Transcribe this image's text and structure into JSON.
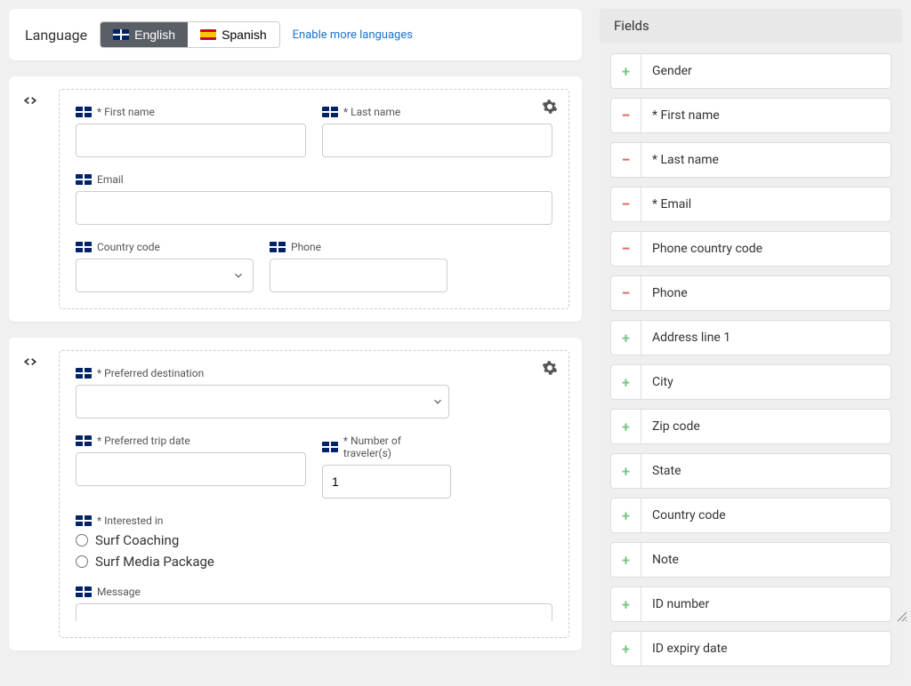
{
  "lang": {
    "label": "Language",
    "english": "English",
    "spanish": "Spanish",
    "more": "Enable more languages"
  },
  "section1": {
    "first_name": "* First name",
    "last_name": "* Last name",
    "email": "Email",
    "country_code": "Country code",
    "phone": "Phone"
  },
  "section2": {
    "destination": "* Preferred destination",
    "trip_date": "* Preferred trip date",
    "travelers": "* Number of traveler(s)",
    "travelers_value": "1",
    "interested": "* Interested in",
    "opt1": "Surf Coaching",
    "opt2": "Surf Media Package",
    "message": "Message"
  },
  "fields": {
    "title": "Fields",
    "items": [
      {
        "action": "add",
        "label": "Gender"
      },
      {
        "action": "remove",
        "label": "* First name"
      },
      {
        "action": "remove",
        "label": "* Last name"
      },
      {
        "action": "remove",
        "label": "* Email"
      },
      {
        "action": "remove",
        "label": "Phone country code"
      },
      {
        "action": "remove",
        "label": "Phone"
      },
      {
        "action": "add",
        "label": "Address line 1"
      },
      {
        "action": "add",
        "label": "City"
      },
      {
        "action": "add",
        "label": "Zip code"
      },
      {
        "action": "add",
        "label": "State"
      },
      {
        "action": "add",
        "label": "Country code"
      },
      {
        "action": "add",
        "label": "Note"
      },
      {
        "action": "add",
        "label": "ID number"
      },
      {
        "action": "add",
        "label": "ID expiry date"
      }
    ]
  }
}
